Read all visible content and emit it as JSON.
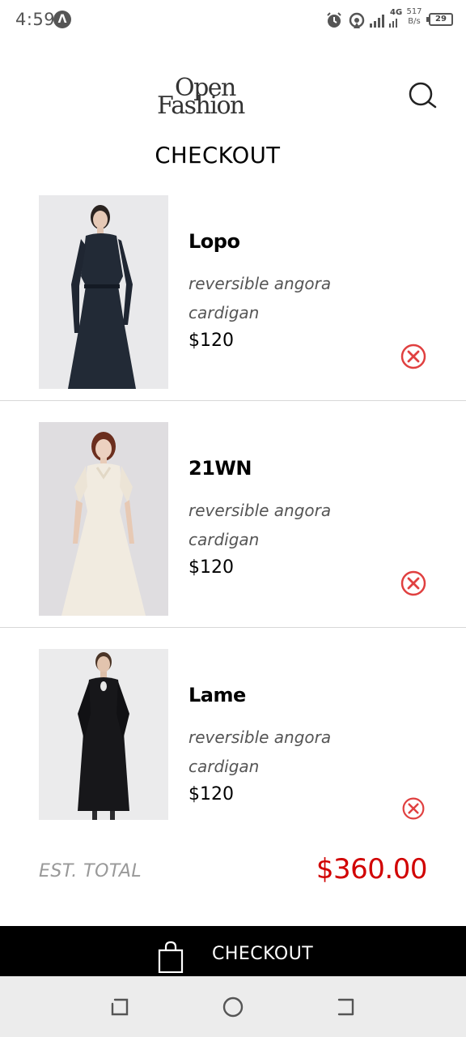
{
  "status_bar": {
    "time": "4:59",
    "notification_badge": "Λ",
    "network_type": "4G",
    "speed_value": "517",
    "speed_unit": "B/s",
    "battery": "29",
    "icons": [
      "alarm-icon",
      "hotspot-icon",
      "signal-icon",
      "signal-icon",
      "battery-icon"
    ]
  },
  "header": {
    "logo_line1": "Open",
    "logo_line2": "Fashion",
    "title": "CHECKOUT",
    "search_icon": "search-icon"
  },
  "cart": {
    "items": [
      {
        "brand": "Lopo",
        "description": "reversible angora cardigan",
        "price": "$120",
        "image": "dark-navy-dress-photo"
      },
      {
        "brand": "21WN",
        "description": "reversible angora cardigan",
        "price": "$120",
        "image": "cream-dress-photo"
      },
      {
        "brand": "Lame",
        "description": "reversible angora cardigan",
        "price": "$120",
        "image": "black-dress-photo"
      }
    ]
  },
  "summary": {
    "est_total_label": "EST. TOTAL",
    "est_total_value": "$360.00"
  },
  "checkout_button": {
    "label": "CHECKOUT",
    "icon": "shopping-bag-icon"
  },
  "nav_bar": {
    "icons": [
      "back-icon",
      "home-icon",
      "recent-apps-icon"
    ]
  },
  "colors": {
    "accent_red": "#d10000",
    "remove_icon": "#e04040",
    "checkout_bar": "#000000",
    "nav_bar": "#ececec"
  }
}
